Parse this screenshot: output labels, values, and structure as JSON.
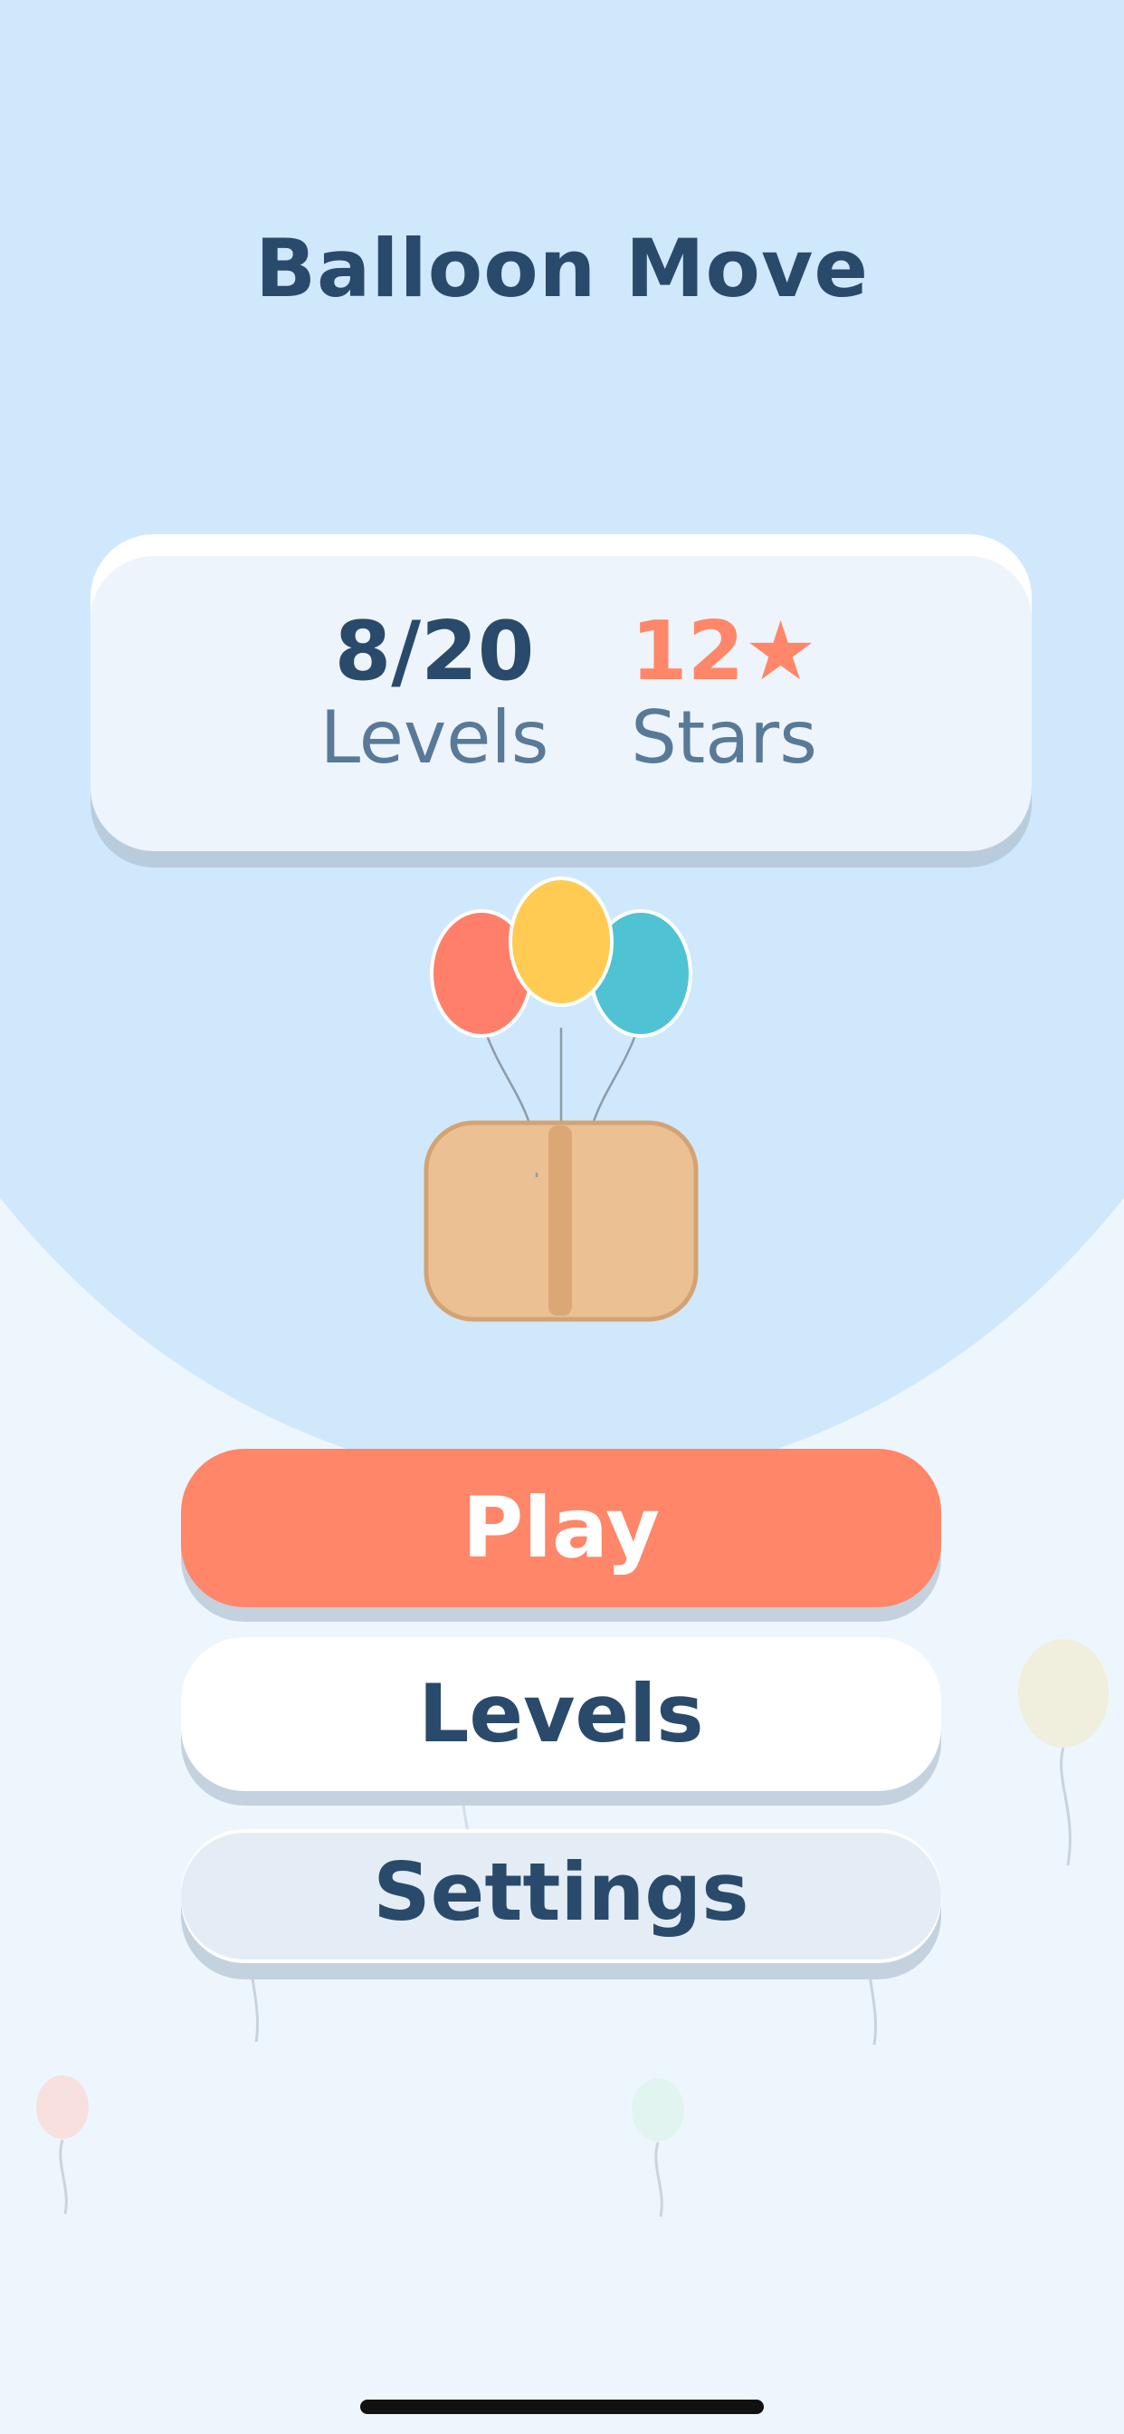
{
  "app": {
    "title": "Balloon Move"
  },
  "stats": {
    "levels_value": "8/20",
    "levels_label": "Levels",
    "stars_value": "12★",
    "stars_label": "Stars"
  },
  "buttons": {
    "play_label": "Play",
    "levels_label": "Levels",
    "settings_label": "Settings"
  },
  "colors": {
    "background": "#EEF6FD",
    "circle": "#D0E8FC",
    "title_text": "#2A4A6C",
    "accent": "#FF8669",
    "balloon_red": "#FF7F6B",
    "balloon_yellow": "#FFCB52",
    "balloon_teal": "#4FC3D4",
    "box": "#EBC193"
  },
  "icons": {
    "star": "star-icon",
    "hero": "balloon-box-illustration"
  }
}
